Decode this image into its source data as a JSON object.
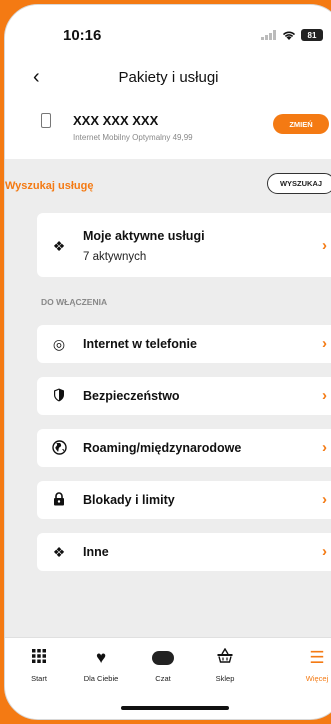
{
  "status_bar": {
    "time": "10:16",
    "battery": "81"
  },
  "header": {
    "title": "Pakiety i usługi"
  },
  "account": {
    "number": "XXX XXX XXX",
    "plan": "Internet Mobilny Optymalny 49,99",
    "change_label": "ZMIEŃ"
  },
  "search": {
    "label": "Wyszukaj usługę",
    "button_label": "WYSZUKAJ"
  },
  "active_services": {
    "title": "Moje aktywne usługi",
    "count_text": "7 aktywnych"
  },
  "section_title": "DO WŁĄCZENIA",
  "items": [
    {
      "label": "Internet w telefonie",
      "icon": "globe-icon"
    },
    {
      "label": "Bezpieczeństwo",
      "icon": "shield-icon"
    },
    {
      "label": "Roaming/międzynarodowe",
      "icon": "earth-icon"
    },
    {
      "label": "Blokady i limity",
      "icon": "lock-icon"
    },
    {
      "label": "Inne",
      "icon": "tickets-icon"
    }
  ],
  "tabs": [
    {
      "label": "Start",
      "icon": "grid-icon"
    },
    {
      "label": "Dla Ciebie",
      "icon": "heart-icon"
    },
    {
      "label": "Czat",
      "icon": "chat-icon"
    },
    {
      "label": "Sklep",
      "icon": "basket-icon"
    },
    {
      "label": "Więcej",
      "icon": "menu-icon"
    }
  ],
  "colors": {
    "accent": "#f47a13",
    "background": "#ededed"
  }
}
